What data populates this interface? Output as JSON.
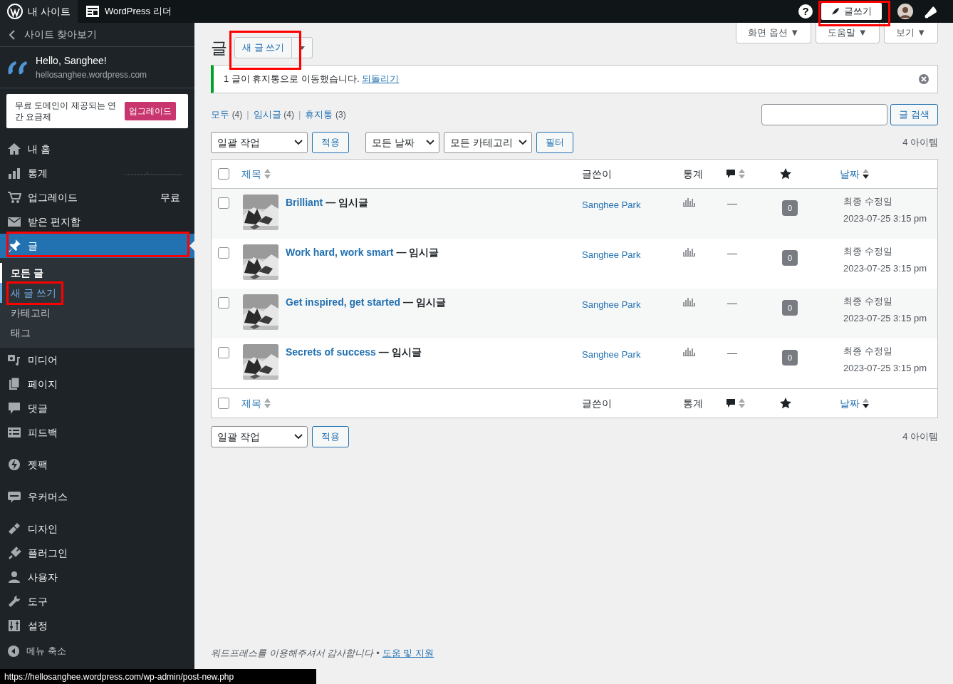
{
  "top_bar": {
    "site_label": "내 사이트",
    "reader_label": "WordPress 리더",
    "help_label": "?",
    "write_button": "글쓰기"
  },
  "sidebar": {
    "back_link": "사이트 찾아보기",
    "greeting": "Hello, Sanghee!",
    "site_url": "hellosanghee.wordpress.com",
    "upsell": {
      "text": "무료 도메인이 제공되는 연간 요금제",
      "button": "업그레이드"
    },
    "menu_groups": [
      [
        {
          "label": "내 홈",
          "selected": false
        },
        {
          "label": "통계",
          "selected": false
        },
        {
          "label": "업그레이드",
          "selected": false,
          "note": "무료"
        },
        {
          "label": "받은 편지함",
          "selected": false
        },
        {
          "label": "글",
          "selected": true,
          "expanded": true,
          "children": [
            {
              "label": "모든 글",
              "selected": true,
              "hovered": false
            },
            {
              "label": "새 글 쓰기",
              "selected": false,
              "hovered": true
            },
            {
              "label": "카테고리",
              "selected": false,
              "hovered": false
            },
            {
              "label": "태그",
              "selected": false,
              "hovered": false
            }
          ]
        },
        {
          "label": "미디어",
          "selected": false
        },
        {
          "label": "페이지",
          "selected": false
        },
        {
          "label": "댓글",
          "selected": false
        },
        {
          "label": "피드백",
          "selected": false
        }
      ],
      [
        {
          "label": "젯팩",
          "selected": false
        }
      ],
      [
        {
          "label": "우커머스",
          "selected": false
        }
      ],
      [
        {
          "label": "디자인",
          "selected": false
        },
        {
          "label": "플러그인",
          "selected": false
        },
        {
          "label": "사용자",
          "selected": false
        },
        {
          "label": "도구",
          "selected": false
        },
        {
          "label": "설정",
          "selected": false
        }
      ]
    ],
    "collapse_label": "메뉴 축소"
  },
  "screen_tabs": [
    "화면 옵션 ▼",
    "도움말 ▼",
    "보기 ▼"
  ],
  "page": {
    "title": "글",
    "add_new": "새 글 쓰기"
  },
  "notice": {
    "text": "1 글이 휴지통으로 이동했습니다.",
    "link": "되돌리기"
  },
  "views": [
    {
      "label": "모두",
      "count": "(4)"
    },
    {
      "separator": "|",
      "label": "임시글",
      "count": "(4)"
    },
    {
      "separator": "|",
      "label": "휴지통",
      "count": "(3)"
    }
  ],
  "search_button": "글 검색",
  "filters": {
    "bulk": "일괄 작업",
    "apply": "적용",
    "dates": "모든 날짜",
    "categories": "모든 카테고리",
    "filter": "필터",
    "count": "4 아이템"
  },
  "table_header": {
    "checked": false,
    "columns": [
      {
        "kind": "text",
        "label": "제목",
        "sorted": false
      },
      {
        "kind": "text",
        "label": "글쓴이"
      },
      {
        "kind": "text",
        "label": "통계"
      },
      {
        "kind": "comment",
        "sorted": false
      },
      {
        "kind": "star"
      },
      {
        "kind": "text",
        "label": "날짜",
        "sorted": true
      }
    ]
  },
  "posts": [
    {
      "title": "Brilliant",
      "state": "— 임시글",
      "author": "Sanghee Park",
      "comments": "—",
      "likes": "0",
      "date_label": "최종 수정일",
      "date": "2023-07-25 3:15 pm",
      "checked": false
    },
    {
      "title": "Work hard, work smart",
      "state": "— 임시글",
      "author": "Sanghee Park",
      "comments": "—",
      "likes": "0",
      "date_label": "최종 수정일",
      "date": "2023-07-25 3:15 pm",
      "checked": false
    },
    {
      "title": "Get inspired, get started",
      "state": "— 임시글",
      "author": "Sanghee Park",
      "comments": "—",
      "likes": "0",
      "date_label": "최종 수정일",
      "date": "2023-07-25 3:15 pm",
      "checked": false
    },
    {
      "title": "Secrets of success",
      "state": "— 임시글",
      "author": "Sanghee Park",
      "comments": "—",
      "likes": "0",
      "date_label": "최종 수정일",
      "date": "2023-07-25 3:15 pm",
      "checked": false
    }
  ],
  "table_footer": {
    "checked": false,
    "columns": [
      {
        "kind": "text",
        "label": "제목",
        "sorted": false
      },
      {
        "kind": "text",
        "label": "글쓴이"
      },
      {
        "kind": "text",
        "label": "통계"
      },
      {
        "kind": "comment",
        "sorted": false
      },
      {
        "kind": "star"
      },
      {
        "kind": "text",
        "label": "날짜",
        "sorted": true
      }
    ]
  },
  "bottom_filters": {
    "bulk": "일괄 작업",
    "apply": "적용",
    "count": "4 아이템"
  },
  "footer": {
    "text": "워드프레스를 이용해주셔서 감사합니다",
    "separator": "•",
    "link": "도움 및 지원"
  },
  "status_url": "https://hellosanghee.wordpress.com/wp-admin/post-new.php"
}
